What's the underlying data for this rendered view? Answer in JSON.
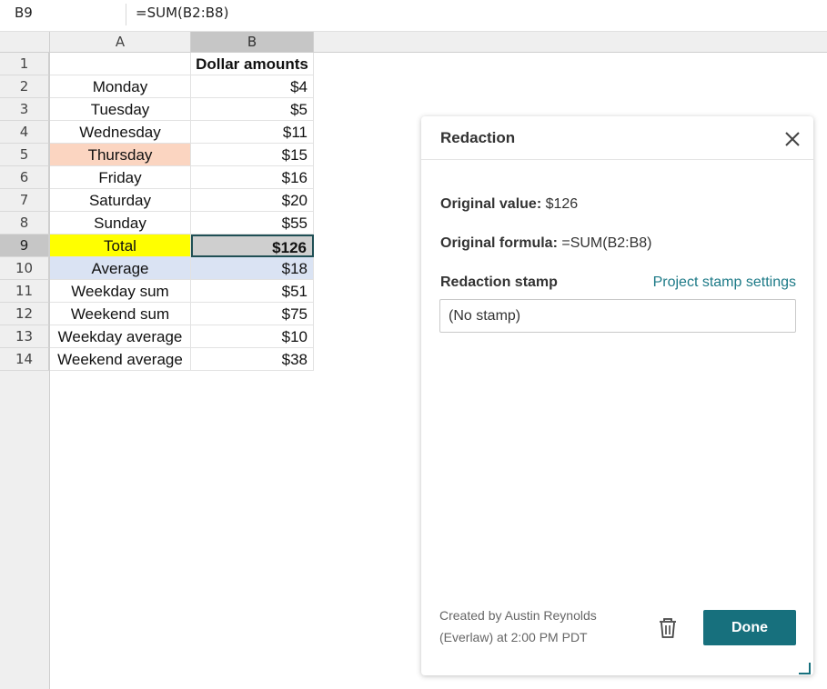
{
  "formula_bar": {
    "cell_reference": "B9",
    "formula": "=SUM(B2:B8)"
  },
  "columns": [
    "A",
    "B"
  ],
  "rows": [
    {
      "num": "1",
      "a": "",
      "b": "Dollar amounts"
    },
    {
      "num": "2",
      "a": "Monday",
      "b": "$4"
    },
    {
      "num": "3",
      "a": "Tuesday",
      "b": "$5"
    },
    {
      "num": "4",
      "a": "Wednesday",
      "b": "$11"
    },
    {
      "num": "5",
      "a": "Thursday",
      "b": "$15"
    },
    {
      "num": "6",
      "a": "Friday",
      "b": "$16"
    },
    {
      "num": "7",
      "a": "Saturday",
      "b": "$20"
    },
    {
      "num": "8",
      "a": "Sunday",
      "b": "$55"
    },
    {
      "num": "9",
      "a": "Total",
      "b": "$126"
    },
    {
      "num": "10",
      "a": "Average",
      "b": "$18"
    },
    {
      "num": "11",
      "a": "Weekday sum",
      "b": "$51"
    },
    {
      "num": "12",
      "a": "Weekend sum",
      "b": "$75"
    },
    {
      "num": "13",
      "a": "Weekday average",
      "b": "$10"
    },
    {
      "num": "14",
      "a": "Weekend average",
      "b": "$38"
    }
  ],
  "colors": {
    "thursday_fill": "#fbd5c1",
    "total_fill": "#ffff00",
    "selected_cell_fill": "#cfcfcf",
    "average_fill": "#dae3f3",
    "accent": "#17707d",
    "link": "#1d7a87"
  },
  "panel": {
    "title": "Redaction",
    "close_icon": "close-icon",
    "original_value_label": "Original value:",
    "original_value": "$126",
    "original_formula_label": "Original formula:",
    "original_formula": "=SUM(B2:B8)",
    "stamp_label": "Redaction stamp",
    "stamp_settings_link": "Project stamp settings",
    "stamp_selected": "(No stamp)",
    "created_by_line1": "Created by Austin Reynolds",
    "created_by_line2": "(Everlaw) at 2:00 PM PDT",
    "delete_icon": "trash-icon",
    "done_label": "Done"
  }
}
